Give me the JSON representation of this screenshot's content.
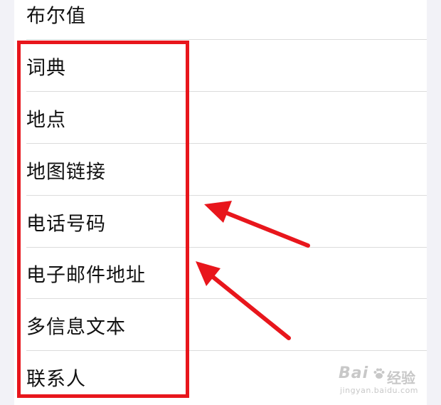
{
  "list": {
    "items": [
      {
        "label": "布尔值"
      },
      {
        "label": "词典"
      },
      {
        "label": "地点"
      },
      {
        "label": "地图链接"
      },
      {
        "label": "电话号码"
      },
      {
        "label": "电子邮件地址"
      },
      {
        "label": "多信息文本"
      },
      {
        "label": "联系人"
      }
    ]
  },
  "annotation": {
    "highlight_color": "#e8161c"
  },
  "watermark": {
    "logo": "Bai",
    "name": "经验",
    "url": "jingyan.baidu.com"
  }
}
